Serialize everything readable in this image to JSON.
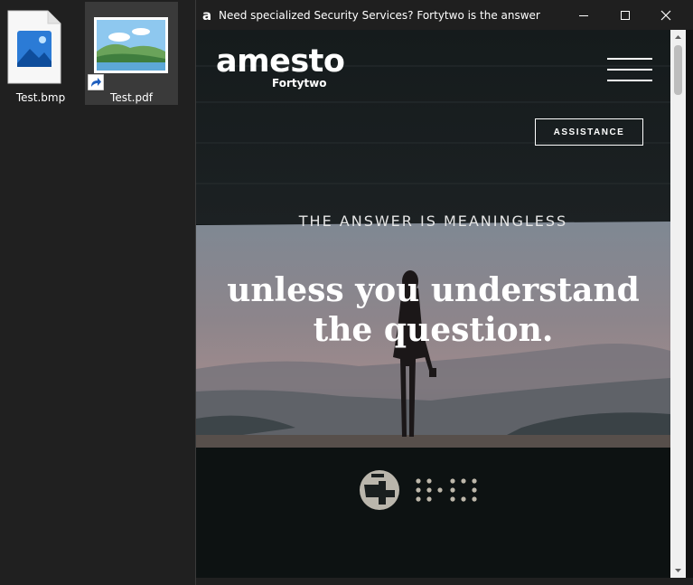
{
  "desktop": {
    "icons": [
      {
        "label": "Test.bmp",
        "icon": "image-file-icon"
      },
      {
        "label": "Test.pdf",
        "icon": "landscape-thumbnail-icon",
        "shortcut": true
      }
    ]
  },
  "window": {
    "title": "Need specialized Security Services? Fortytwo is the answer",
    "app_icon": "amesto-a-icon",
    "controls": [
      "minimize-icon",
      "maximize-icon",
      "close-icon"
    ]
  },
  "page": {
    "brand": {
      "name": "amesto",
      "sub": "Fortytwo"
    },
    "menu_icon": "hamburger-menu-icon",
    "assistance_label": "ASSISTANCE",
    "kicker": "THE ANSWER IS MEANINGLESS",
    "headline": [
      "unless you understand",
      "the question."
    ],
    "footer_logo_icon": "fortytwo-42-logo-icon"
  },
  "colors": {
    "desktop_bg": "#202020",
    "titlebar_bg": "#1f1f1f",
    "page_bg": "#0e1313",
    "accent_text": "#ffffff"
  }
}
